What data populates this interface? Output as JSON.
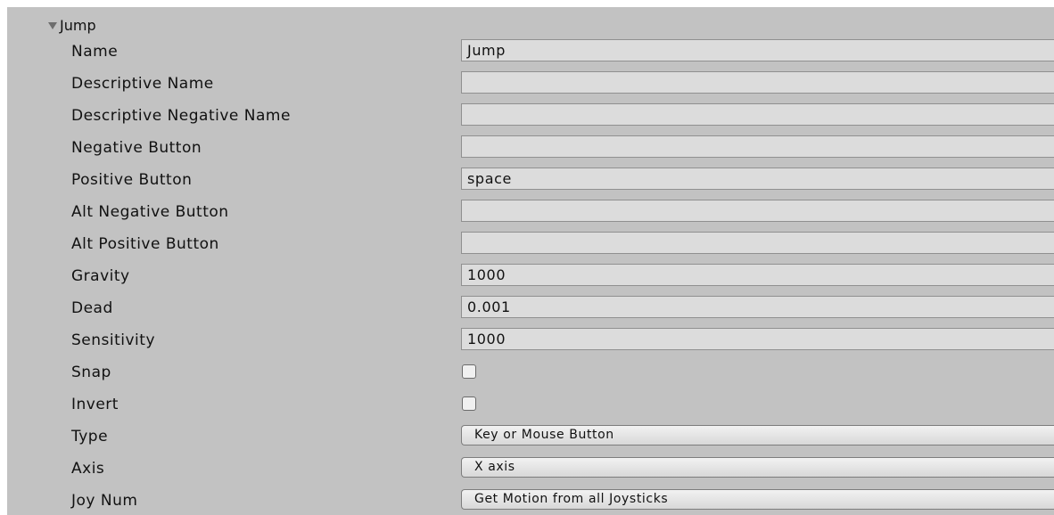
{
  "section": {
    "title": "Jump",
    "toggle_icon": "triangle-down-icon"
  },
  "fields": {
    "name": {
      "label": "Name",
      "value": "Jump"
    },
    "descriptive_name": {
      "label": "Descriptive Name",
      "value": ""
    },
    "descriptive_negative_name": {
      "label": "Descriptive Negative Name",
      "value": ""
    },
    "negative_button": {
      "label": "Negative Button",
      "value": ""
    },
    "positive_button": {
      "label": "Positive Button",
      "value": "space"
    },
    "alt_negative_button": {
      "label": "Alt Negative Button",
      "value": ""
    },
    "alt_positive_button": {
      "label": "Alt Positive Button",
      "value": ""
    },
    "gravity": {
      "label": "Gravity",
      "value": "1000"
    },
    "dead": {
      "label": "Dead",
      "value": "0.001"
    },
    "sensitivity": {
      "label": "Sensitivity",
      "value": "1000"
    },
    "snap": {
      "label": "Snap",
      "checked": false
    },
    "invert": {
      "label": "Invert",
      "checked": false
    },
    "type": {
      "label": "Type",
      "value": "Key or Mouse Button"
    },
    "axis": {
      "label": "Axis",
      "value": "X axis"
    },
    "joy_num": {
      "label": "Joy Num",
      "value": "Get Motion from all Joysticks"
    }
  },
  "colors": {
    "panel_background": "#c2c2c2",
    "field_background": "#dcdcdc",
    "checkbox_background": "#f0f0f0"
  }
}
